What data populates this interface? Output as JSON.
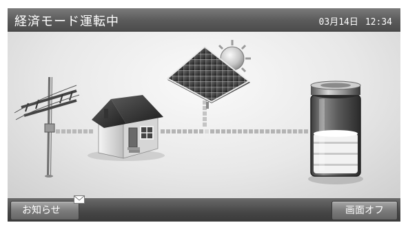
{
  "header": {
    "title": "経済モード運転中",
    "date": "03月14日",
    "time": "12:34"
  },
  "footer": {
    "news_label": "お知らせ",
    "screen_off_label": "画面オフ"
  },
  "icons": [
    "power-pole-icon",
    "house-icon",
    "solar-panel-icon",
    "sun-icon",
    "battery-icon",
    "mail-icon"
  ],
  "colors": {
    "titlebar": "#5a5a5a",
    "background": "#e8e8e8",
    "battery_level": "#f2f2f2"
  },
  "battery": {
    "level_fraction": 0.45
  }
}
